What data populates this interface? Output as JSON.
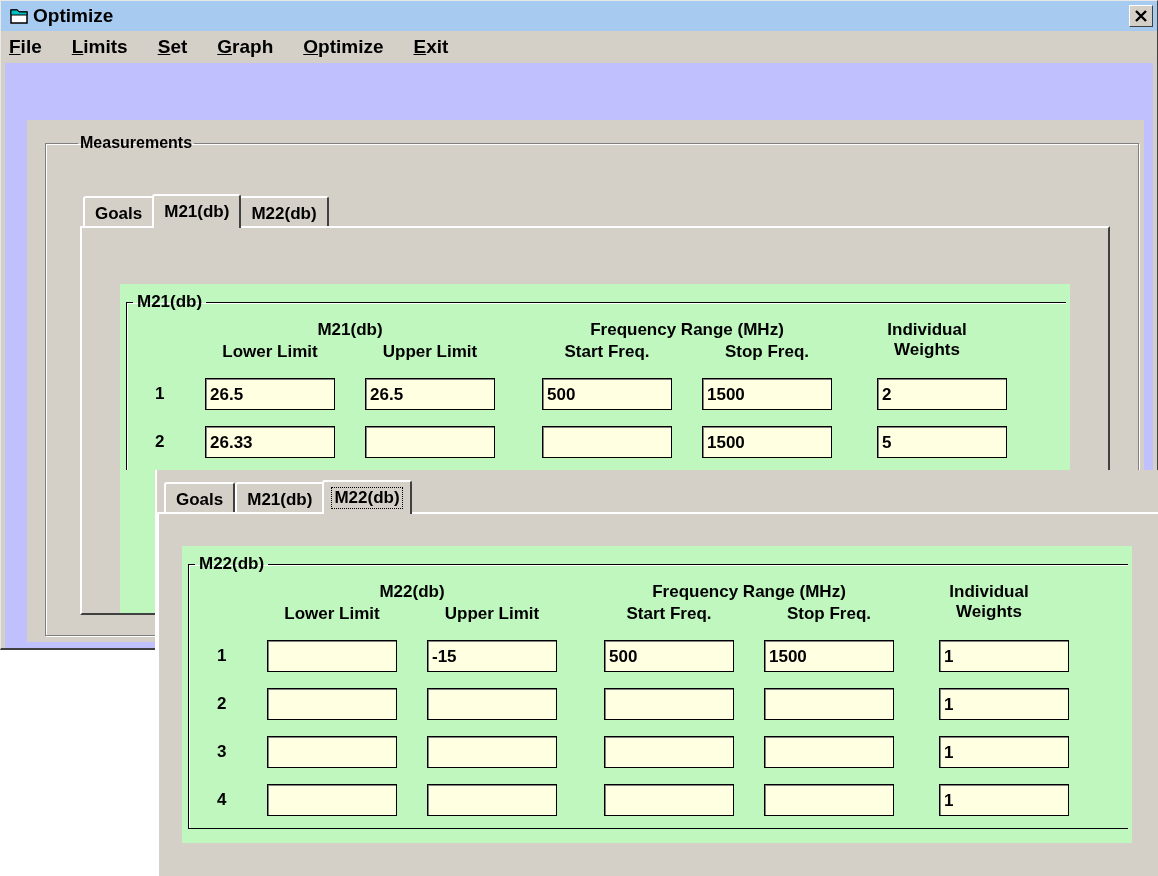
{
  "window": {
    "title": "Optimize",
    "menu": [
      {
        "label": "File"
      },
      {
        "label": "Limits"
      },
      {
        "label": "Set"
      },
      {
        "label": "Graph"
      },
      {
        "label": "Optimize"
      },
      {
        "label": "Exit"
      }
    ]
  },
  "measurements": {
    "title": "Measurements",
    "tabs": [
      {
        "label": "Goals",
        "selected": false,
        "focused": false
      },
      {
        "label": "M21(db)",
        "selected": true,
        "focused": false
      },
      {
        "label": "M22(db)",
        "selected": false,
        "focused": false
      }
    ],
    "group": {
      "title": "M21(db)",
      "header": "M21(db)",
      "range_header": "Frequency Range (MHz)",
      "weights_header": "Individual Weights",
      "columns": [
        "Lower Limit",
        "Upper Limit",
        "Start Freq.",
        "Stop Freq."
      ],
      "rows": [
        {
          "index": "1",
          "lower": "26.5",
          "upper": "26.5",
          "start": "500",
          "stop": "1500",
          "weight": "2"
        },
        {
          "index": "2",
          "lower": "26.33",
          "stop": "1500",
          "weight": "5"
        }
      ]
    }
  },
  "overlay": {
    "tabs": [
      {
        "label": "Goals",
        "selected": false,
        "focused": false
      },
      {
        "label": "M21(db)",
        "selected": false,
        "focused": false
      },
      {
        "label": "M22(db)",
        "selected": true,
        "focused": true
      }
    ],
    "group": {
      "title": "M22(db)",
      "header": "M22(db)",
      "range_header": "Frequency Range (MHz)",
      "weights_header": "Individual Weights",
      "columns": [
        "Lower Limit",
        "Upper Limit",
        "Start Freq.",
        "Stop Freq."
      ],
      "rows": [
        {
          "index": "1",
          "upper": "-15",
          "start": "500",
          "stop": "1500",
          "weight": "1"
        },
        {
          "index": "2",
          "weight": "1"
        },
        {
          "index": "3",
          "weight": "1"
        },
        {
          "index": "4",
          "weight": "1"
        }
      ]
    }
  }
}
